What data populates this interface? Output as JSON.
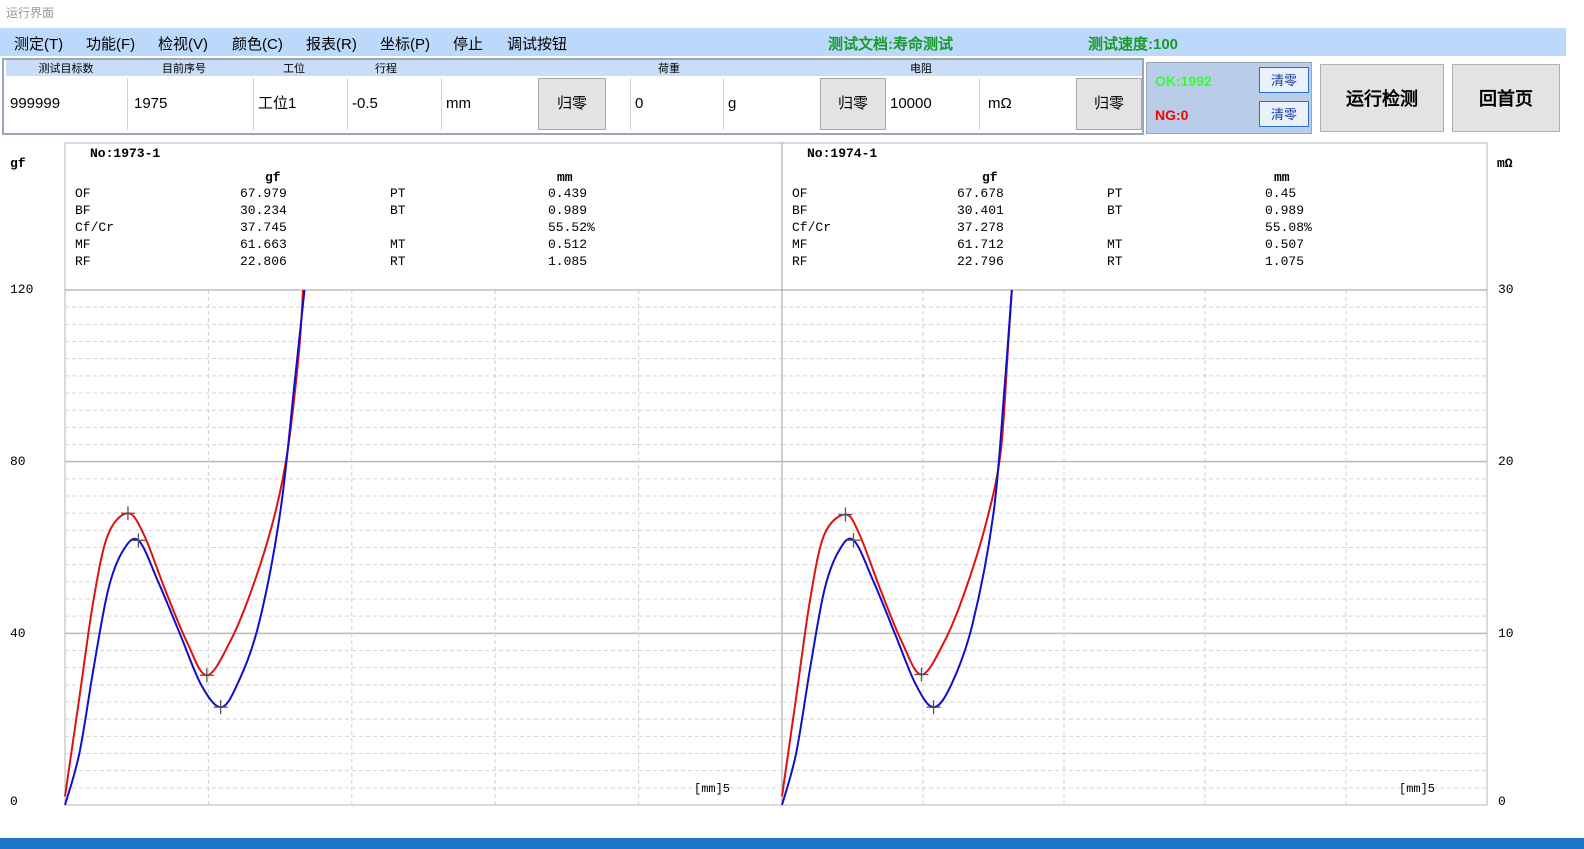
{
  "window": {
    "title": "运行界面"
  },
  "menu": {
    "items": [
      "测定(T)",
      "功能(F)",
      "检视(V)",
      "颜色(C)",
      "报表(R)",
      "坐标(P)",
      "停止",
      "调试按钮"
    ],
    "test_doc": "测试文档:寿命测试",
    "test_speed": "测试速度:100"
  },
  "panel": {
    "headers": {
      "target": "测试目标数",
      "seq": "目前序号",
      "station": "工位",
      "stroke": "行程",
      "load": "荷重",
      "resistance": "电阻"
    },
    "target_value": "999999",
    "seq_value": "1975",
    "station_value": "工位1",
    "stroke_value": "-0.5",
    "stroke_unit": "mm",
    "load_value": "0",
    "load_unit": "g",
    "res_value": "10000",
    "res_unit": "mΩ",
    "zero_label": "归零"
  },
  "counters": {
    "ok": "OK:1992",
    "ng": "NG:0",
    "clear_label": "清零"
  },
  "buttons": {
    "run": "运行检测",
    "home": "回首页"
  },
  "plot": {
    "left_unit": "gf",
    "right_unit": "mΩ",
    "left_ticks": [
      "120",
      "80",
      "40",
      "0"
    ],
    "right_ticks": [
      "30",
      "20",
      "10",
      "0"
    ],
    "x_label": "[mm]5",
    "colors": {
      "force_curve": "#e01010",
      "return_curve": "#1010c8"
    }
  },
  "chart_data": [
    {
      "type": "line",
      "title": "No:1973-1",
      "ylim": [
        0,
        120
      ],
      "y2lim": [
        0,
        30
      ],
      "xlim": [
        0,
        5
      ],
      "stats_headers": [
        "gf",
        "mm"
      ],
      "stats": [
        {
          "label": "OF",
          "value": "67.979",
          "label2": "PT",
          "value2": "0.439"
        },
        {
          "label": "BF",
          "value": "30.234",
          "label2": "BT",
          "value2": "0.989"
        },
        {
          "label": "Cf/Cr",
          "value": "37.745",
          "label2": "",
          "value2": "55.52%"
        },
        {
          "label": "MF",
          "value": "61.663",
          "label2": "MT",
          "value2": "0.512"
        },
        {
          "label": "RF",
          "value": "22.806",
          "label2": "RT",
          "value2": "1.085"
        }
      ],
      "series": [
        {
          "x": [
            0,
            0.1,
            0.2,
            0.3,
            0.439,
            0.55,
            0.7,
            0.85,
            0.989,
            1.15,
            1.3,
            1.45,
            1.55,
            1.63,
            1.66
          ],
          "values": [
            2,
            25,
            48,
            63,
            67.979,
            63,
            50,
            38,
            30.234,
            38,
            50,
            66,
            82,
            105,
            120
          ]
        },
        {
          "x": [
            0,
            0.1,
            0.2,
            0.3,
            0.4,
            0.512,
            0.65,
            0.8,
            0.95,
            1.085,
            1.2,
            1.35,
            1.5,
            1.6,
            1.67
          ],
          "values": [
            0,
            12,
            32,
            50,
            59,
            61.663,
            52,
            40,
            28,
            22.806,
            28,
            42,
            68,
            98,
            120
          ]
        }
      ]
    },
    {
      "type": "line",
      "title": "No:1974-1",
      "ylim": [
        0,
        120
      ],
      "y2lim": [
        0,
        30
      ],
      "xlim": [
        0,
        5
      ],
      "stats_headers": [
        "gf",
        "mm"
      ],
      "stats": [
        {
          "label": "OF",
          "value": "67.678",
          "label2": "PT",
          "value2": "0.45"
        },
        {
          "label": "BF",
          "value": "30.401",
          "label2": "BT",
          "value2": "0.989"
        },
        {
          "label": "Cf/Cr",
          "value": "37.278",
          "label2": "",
          "value2": "55.08%"
        },
        {
          "label": "MF",
          "value": "61.712",
          "label2": "MT",
          "value2": "0.507"
        },
        {
          "label": "RF",
          "value": "22.796",
          "label2": "RT",
          "value2": "1.075"
        }
      ],
      "series": [
        {
          "x": [
            0,
            0.1,
            0.2,
            0.3,
            0.45,
            0.55,
            0.7,
            0.85,
            0.989,
            1.15,
            1.3,
            1.45,
            1.55,
            1.6,
            1.63
          ],
          "values": [
            2,
            25,
            48,
            63,
            67.678,
            63,
            50,
            38,
            30.401,
            38,
            50,
            66,
            82,
            105,
            120
          ]
        },
        {
          "x": [
            0,
            0.1,
            0.2,
            0.3,
            0.4,
            0.507,
            0.65,
            0.8,
            0.95,
            1.075,
            1.2,
            1.35,
            1.5,
            1.58,
            1.63
          ],
          "values": [
            0,
            12,
            32,
            50,
            59,
            61.712,
            52,
            40,
            28,
            22.796,
            28,
            42,
            68,
            98,
            120
          ]
        }
      ]
    }
  ]
}
